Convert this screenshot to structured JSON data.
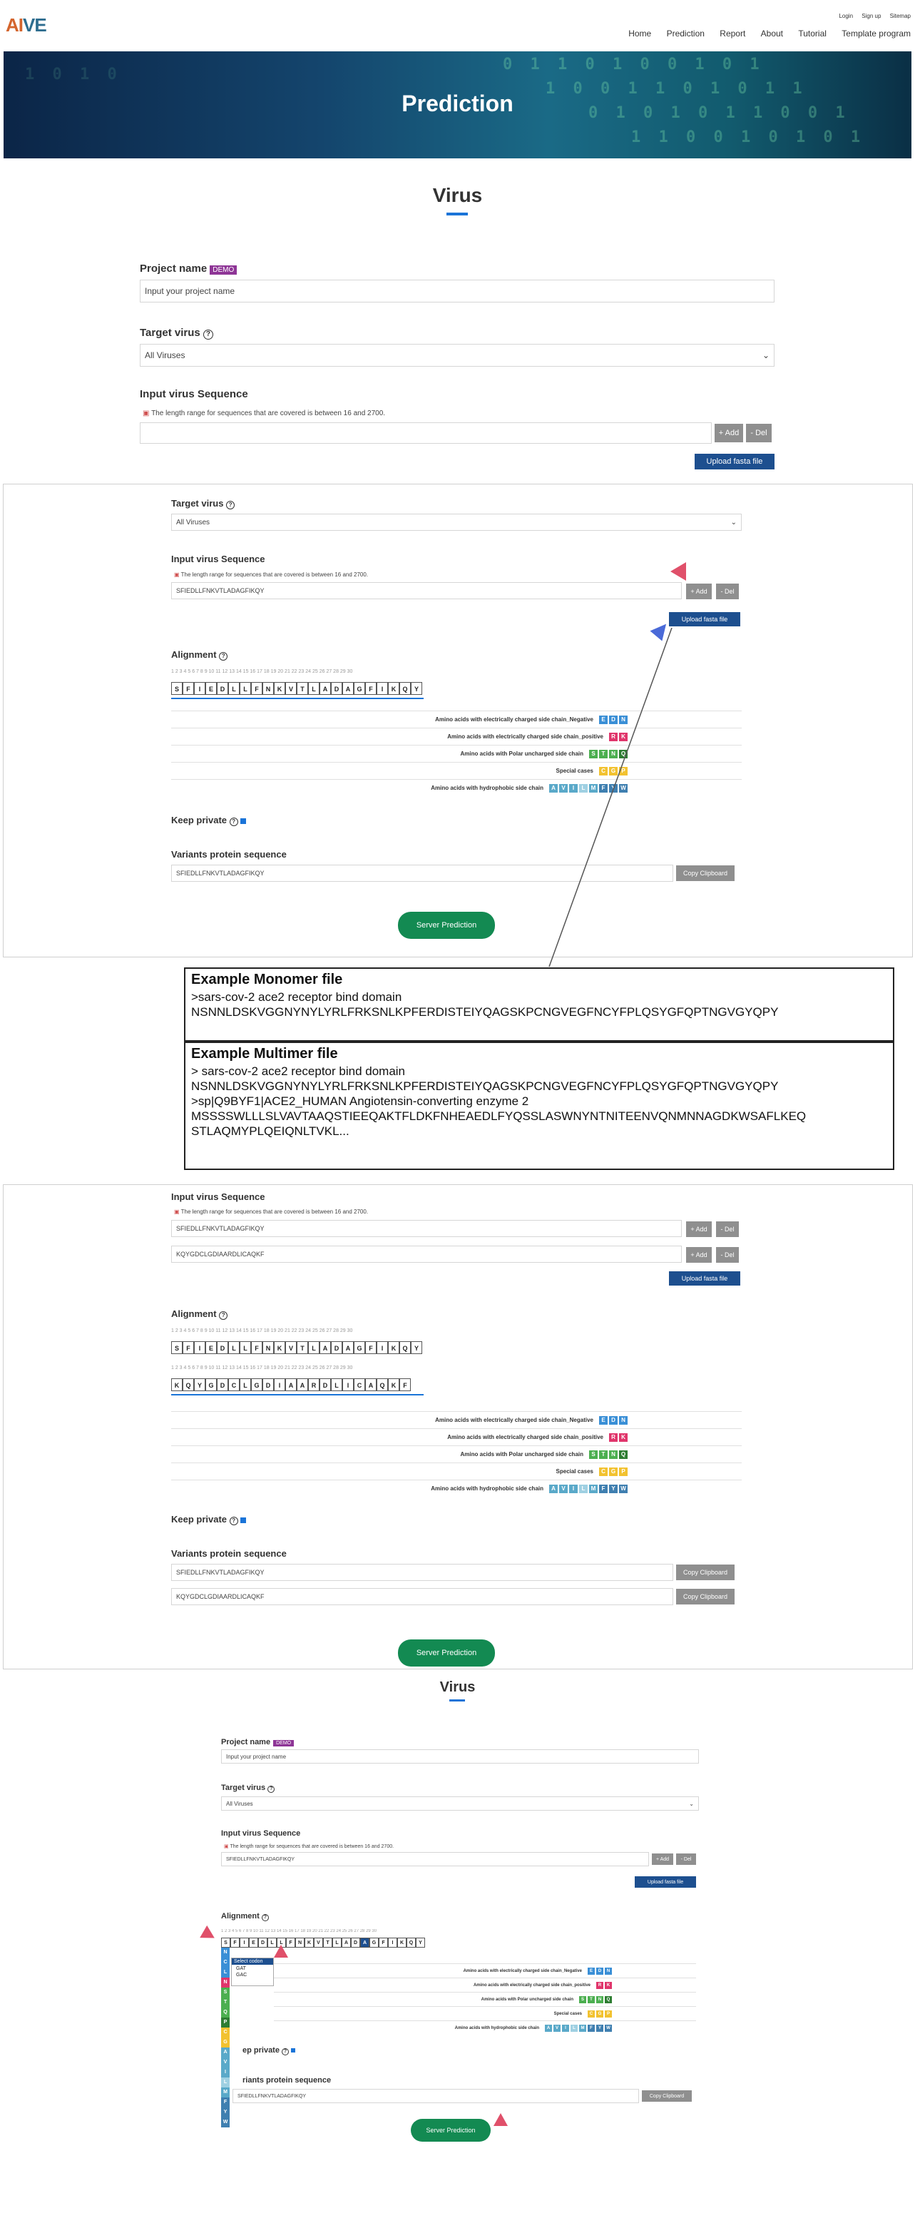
{
  "nav": {
    "logo_a": "AI",
    "logo_b": "VE",
    "top_links": [
      "Login",
      "Sign up",
      "Sitemap"
    ],
    "menu": [
      "Home",
      "Prediction",
      "Report",
      "About",
      "Tutorial",
      "Template program"
    ]
  },
  "banner": {
    "title": "Prediction"
  },
  "section_title": "Virus",
  "form": {
    "project_name_label": "Project name",
    "demo_badge": "DEMO",
    "project_placeholder": "Input your project name",
    "target_virus_label": "Target virus",
    "target_virus_value": "All Viruses",
    "input_seq_label": "Input virus Sequence",
    "length_note": "The length range for sequences that are covered is between 16 and 2700.",
    "add_label": "+ Add",
    "del_label": "- Del",
    "upload_label": "Upload fasta file",
    "alignment_label": "Alignment",
    "keep_private_label": "Keep private",
    "variants_label": "Variants protein sequence",
    "copy_label": "Copy Clipboard",
    "server_prediction_label": "Server Prediction"
  },
  "sequences": {
    "seq1": "SFIEDLLFNKVTLADAGFIKQY",
    "seq2": "KQYGDCLGDIAARDLICAQKF"
  },
  "alignment": {
    "ruler": "1 2 3 4 5 6 7 8 9 10 11 12 13 14 15 16 17 18 19 20 21 22 23 24 25 26 27 28 29 30",
    "residues1": [
      "S",
      "F",
      "I",
      "E",
      "D",
      "L",
      "L",
      "F",
      "N",
      "K",
      "V",
      "T",
      "L",
      "A",
      "D",
      "A",
      "G",
      "F",
      "I",
      "K",
      "Q",
      "Y"
    ],
    "residues2": [
      "K",
      "Q",
      "Y",
      "G",
      "D",
      "C",
      "L",
      "G",
      "D",
      "I",
      "A",
      "A",
      "R",
      "D",
      "L",
      "I",
      "C",
      "A",
      "Q",
      "K",
      "F"
    ]
  },
  "legend": [
    {
      "text": "Amino acids with electrically charged side chain_Negative",
      "swatches": [
        "E",
        "D",
        "N"
      ],
      "colors": [
        "#3a8fd6",
        "#3a8fd6",
        "#3a8fd6"
      ]
    },
    {
      "text": "Amino acids with electrically charged side chain_positive",
      "swatches": [
        "R",
        "K"
      ],
      "colors": [
        "#e0356b",
        "#e0356b"
      ]
    },
    {
      "text": "Amino acids with Polar uncharged side chain",
      "swatches": [
        "S",
        "T",
        "N",
        "Q"
      ],
      "colors": [
        "#4caf50",
        "#4caf50",
        "#4caf50",
        "#2e7d32"
      ]
    },
    {
      "text": "Special cases",
      "swatches": [
        "C",
        "G",
        "P"
      ],
      "colors": [
        "#f2c230",
        "#f2c230",
        "#f2c230"
      ]
    },
    {
      "text": "Amino acids with hydrophobic side chain",
      "swatches": [
        "A",
        "V",
        "I",
        "L",
        "M",
        "F",
        "Y",
        "W"
      ],
      "colors": [
        "#5aa9c9",
        "#5aa9c9",
        "#5aa9c9",
        "#9fd0e2",
        "#5aa9c9",
        "#3f7fb0",
        "#3f7fb0",
        "#3f7fb0"
      ]
    }
  ],
  "examples": {
    "monomer_title": "Example Monomer file",
    "monomer_lines": [
      ">sars-cov-2 ace2 receptor bind domain",
      "NSNNLDSKVGGNYNYLYRLFRKSNLKPFERDISTEIYQAGSKPCNGVEGFNCYFPLQSYGFQPTNGVGYQPY"
    ],
    "multimer_title": "Example Multimer file",
    "multimer_lines": [
      "> sars-cov-2 ace2 receptor bind domain",
      "NSNNLDSKVGGNYNYLYRLFRKSNLKPFERDISTEIYQAGSKPCNGVEGFNCYFPLQSYGFQPTNGVGYQPY",
      ">sp|Q9BYF1|ACE2_HUMAN Angiotensin-converting enzyme 2",
      "MSSSSWLLLSLVAVTAAQSTIEEQAKTFLDKFNHEAEDLFYQSSLASWNYNTNITEENVQNMNNAGDKWSAFLKEQ",
      "STLAQMYPLQEIQNLTVKL..."
    ]
  },
  "dropdown": {
    "title": "Select codon",
    "opt1": "GAT",
    "opt2": "GAC"
  },
  "vertical_letters": [
    "N",
    "C",
    "L",
    "N",
    "S",
    "T",
    "Q",
    "P",
    "C",
    "G",
    "A",
    "V",
    "I",
    "L",
    "M",
    "F",
    "Y",
    "W"
  ],
  "vertical_colors": [
    "#3a8fd6",
    "#3a8fd6",
    "#3a8fd6",
    "#e0356b",
    "#4caf50",
    "#4caf50",
    "#4caf50",
    "#2e7d32",
    "#f2c230",
    "#f2c230",
    "#5aa9c9",
    "#5aa9c9",
    "#5aa9c9",
    "#9fd0e2",
    "#5aa9c9",
    "#3f7fb0",
    "#3f7fb0",
    "#3f7fb0"
  ],
  "accent": {
    "red": "#e0506a",
    "blue": "#4a6ad8"
  }
}
